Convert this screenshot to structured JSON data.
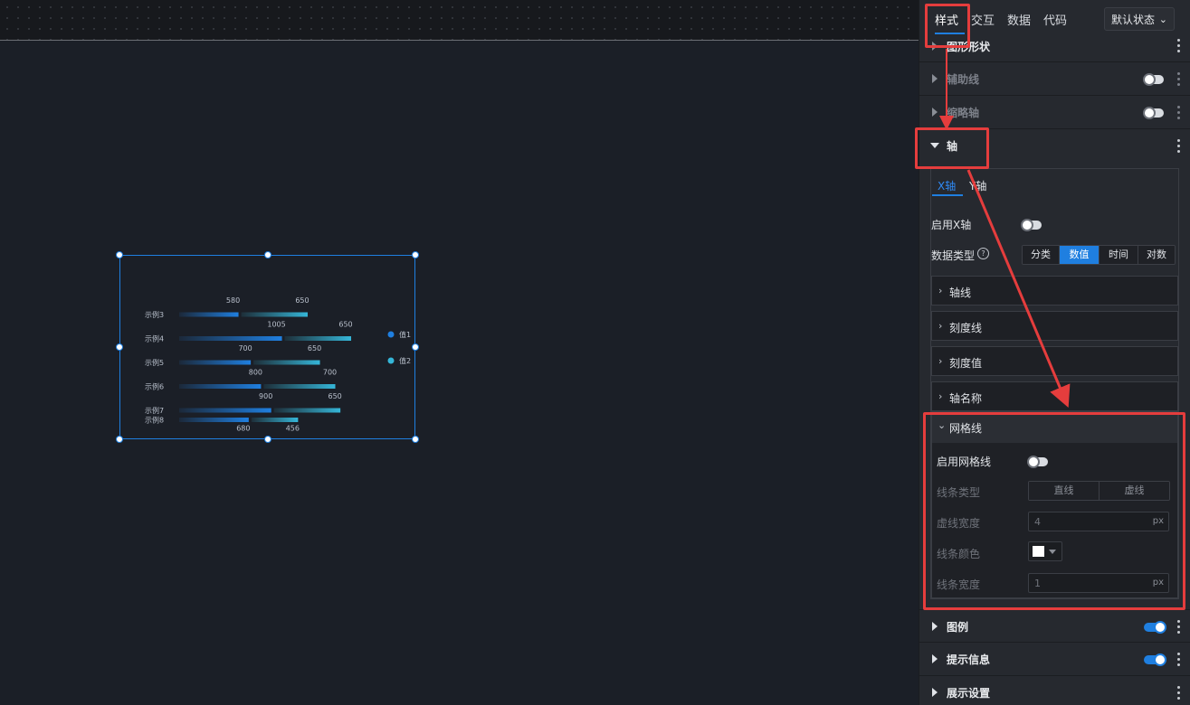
{
  "top_tabs": [
    "样式",
    "交互",
    "数据",
    "代码"
  ],
  "state_select": {
    "value": "默认状态",
    "chevron_icon": "chevron-down-icon"
  },
  "sections": {
    "shape": {
      "label": "图形形状"
    },
    "guide_line": {
      "label": "辅助线",
      "enabled": false
    },
    "thumb_axis": {
      "label": "缩略轴",
      "enabled": false
    },
    "axis": {
      "label": "轴"
    },
    "legend": {
      "label": "图例",
      "enabled": true
    },
    "tooltip": {
      "label": "提示信息",
      "enabled": true
    },
    "display": {
      "label": "展示设置"
    }
  },
  "axis_panel": {
    "tabs": [
      "X轴",
      "Y轴"
    ],
    "enable_label": "启用X轴",
    "enabled": false,
    "data_type_label": "数据类型",
    "help_icon": "question-circle-icon",
    "data_types": [
      "分类",
      "数值",
      "时间",
      "对数"
    ],
    "selected_type": "数值",
    "folds": [
      "轴线",
      "刻度线",
      "刻度值",
      "轴名称"
    ]
  },
  "grid": {
    "title": "网格线",
    "enable_label": "启用网格线",
    "enabled": false,
    "line_type_label": "线条类型",
    "line_types": [
      "直线",
      "虚线"
    ],
    "dash_width_label": "虚线宽度",
    "dash_width": "4",
    "unit": "px",
    "line_color_label": "线条颜色",
    "line_color": "#ffffff",
    "line_width_label": "线条宽度",
    "line_width": "1"
  },
  "chart_data": {
    "type": "bar",
    "orientation": "horizontal",
    "categories": [
      "示例3",
      "示例4",
      "示例5",
      "示例6",
      "示例7",
      "示例8"
    ],
    "series": [
      {
        "name": "值1",
        "values": [
          580,
          1005,
          700,
          800,
          900,
          680
        ],
        "color": "#1f7fe0"
      },
      {
        "name": "值2",
        "values": [
          650,
          650,
          650,
          700,
          650,
          456
        ],
        "color": "#35b6d8"
      }
    ],
    "legend_position": "right"
  },
  "colors": {
    "accent": "#1f7fe0",
    "annotation": "#e53d3d"
  }
}
